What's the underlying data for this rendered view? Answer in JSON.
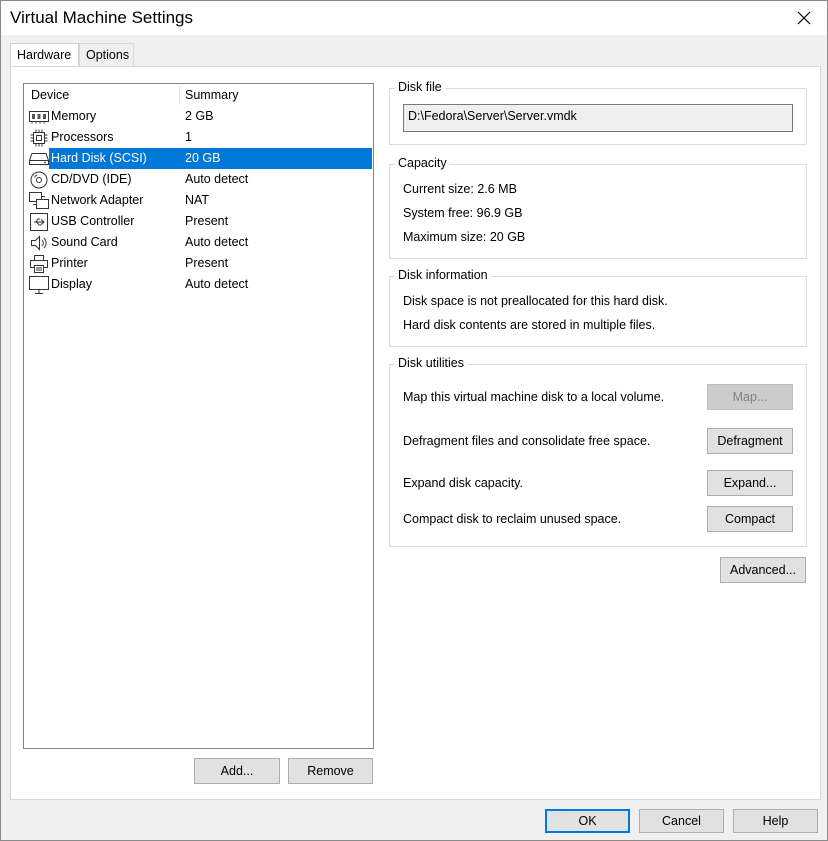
{
  "window": {
    "title": "Virtual Machine Settings"
  },
  "tabs": [
    {
      "label": "Hardware"
    },
    {
      "label": "Options"
    }
  ],
  "device_list": {
    "columns": {
      "device": "Device",
      "summary": "Summary"
    },
    "rows": [
      {
        "device": "Memory",
        "summary": "2 GB",
        "icon": "memory-icon"
      },
      {
        "device": "Processors",
        "summary": "1",
        "icon": "processor-icon"
      },
      {
        "device": "Hard Disk (SCSI)",
        "summary": "20 GB",
        "icon": "hard-disk-icon",
        "selected": true
      },
      {
        "device": "CD/DVD (IDE)",
        "summary": "Auto detect",
        "icon": "cd-dvd-icon"
      },
      {
        "device": "Network Adapter",
        "summary": "NAT",
        "icon": "network-adapter-icon"
      },
      {
        "device": "USB Controller",
        "summary": "Present",
        "icon": "usb-icon"
      },
      {
        "device": "Sound Card",
        "summary": "Auto detect",
        "icon": "speaker-icon"
      },
      {
        "device": "Printer",
        "summary": "Present",
        "icon": "printer-icon"
      },
      {
        "device": "Display",
        "summary": "Auto detect",
        "icon": "monitor-icon"
      }
    ]
  },
  "list_buttons": {
    "add": "Add...",
    "remove": "Remove"
  },
  "disk_file": {
    "title": "Disk file",
    "path": "D:\\Fedora\\Server\\Server.vmdk"
  },
  "capacity": {
    "title": "Capacity",
    "current_size": "Current size: 2.6 MB",
    "system_free": "System free: 96.9 GB",
    "maximum_size": "Maximum size: 20 GB"
  },
  "disk_information": {
    "title": "Disk information",
    "line1": "Disk space is not preallocated for this hard disk.",
    "line2": "Hard disk contents are stored in multiple files."
  },
  "disk_utilities": {
    "title": "Disk utilities",
    "map_text": "Map this virtual machine disk to a local volume.",
    "map_button": "Map...",
    "defrag_text": "Defragment files and consolidate free space.",
    "defrag_button": "Defragment",
    "expand_text": "Expand disk capacity.",
    "expand_button": "Expand...",
    "compact_text": "Compact disk to reclaim unused space.",
    "compact_button": "Compact"
  },
  "advanced_button": "Advanced...",
  "footer": {
    "ok": "OK",
    "cancel": "Cancel",
    "help": "Help"
  },
  "colors": {
    "selection": "#0078d7",
    "panel": "#ffffff",
    "window": "#f0f0f0"
  }
}
